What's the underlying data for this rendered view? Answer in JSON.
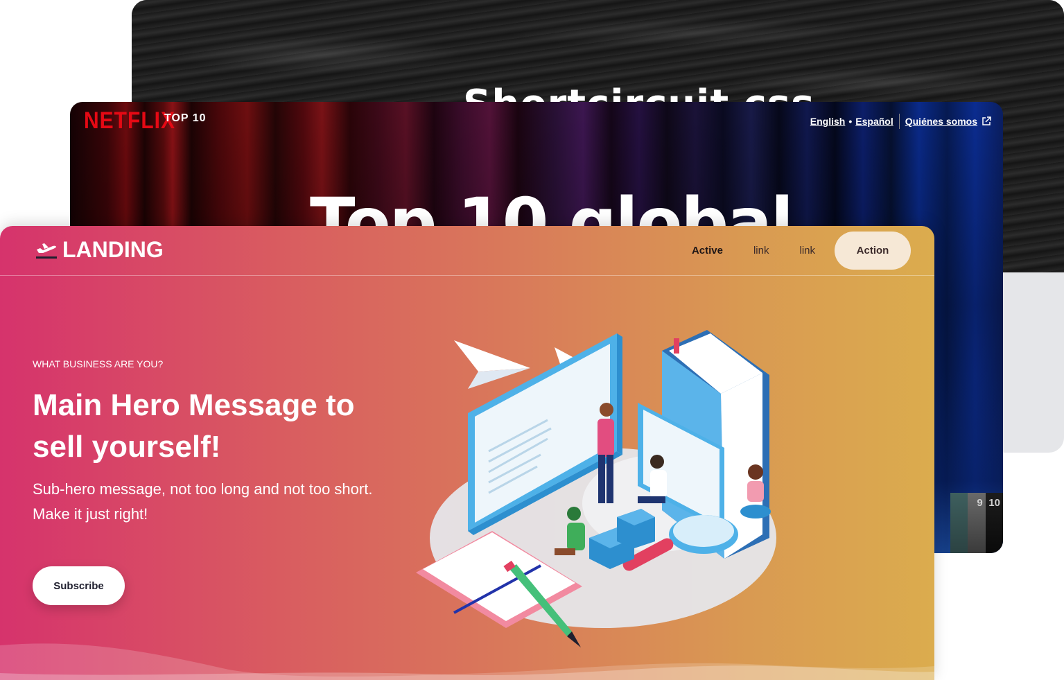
{
  "back_card": {
    "title": "Shortcircuit css"
  },
  "netflix": {
    "logo": "NETFLIX",
    "section": "TOP 10",
    "links": {
      "english": "English",
      "separator": "•",
      "spanish": "Español",
      "about": "Quiénes somos"
    },
    "headline": "Top 10 global",
    "ranks": [
      "9",
      "10"
    ]
  },
  "landing": {
    "logo_text": "LANDING",
    "nav": {
      "active": "Active",
      "link1": "link",
      "link2": "link",
      "action": "Action"
    },
    "eyebrow": "WHAT BUSINESS ARE YOU?",
    "title": "Main Hero Message to sell yourself!",
    "subtitle": "Sub-hero message, not too long and not too short. Make it just right!",
    "cta": "Subscribe"
  },
  "colors": {
    "netflix_red": "#e50914",
    "landing_gradient_start": "#d6336c",
    "landing_gradient_end": "#dbac4e",
    "action_bg": "#f6e8d6"
  }
}
